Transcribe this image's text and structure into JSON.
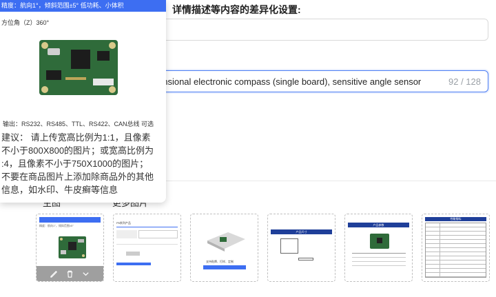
{
  "form": {
    "section_title": "详情描述等内容的差异化设置:",
    "title_input_value": "ensional electronic compass (single board), sensitive angle sensor",
    "title_input_count": "92 / 128"
  },
  "tabs": {
    "left_partial": "主图",
    "right_partial": "更多图片"
  },
  "popover": {
    "banner_text": "精度：航向1°，倾斜范围±5°    低功耗、小体积",
    "spec_line": "方位角（Z）360°",
    "output_line": "输出：RS232、RS485、TTL、RS422、CAN总线 可选",
    "advice_lines": [
      "建议：  请上传宽高比例为1:1，且像素",
      "不小于800X800的图片；或宽高比例为",
      ":4，且像素不小于750X1000的图片；",
      "不要在商品图片上添加除商品外的其他",
      "信息，如水印、牛皮癣等信息"
    ]
  },
  "thumbnails": [
    {
      "caption": "精度：航向1°，倾斜范围±5°",
      "has_actions": true
    },
    {
      "caption": "P5系列产品"
    },
    {
      "caption": "支持贴牌、打样、定制"
    },
    {
      "caption": "产品尺寸"
    },
    {
      "caption": "产品参数"
    },
    {
      "caption": "性能指标"
    }
  ],
  "colors": {
    "accent": "#3d6ef2",
    "focus_border": "#4a7cf3",
    "pcb_green": "#2f6b3a"
  }
}
